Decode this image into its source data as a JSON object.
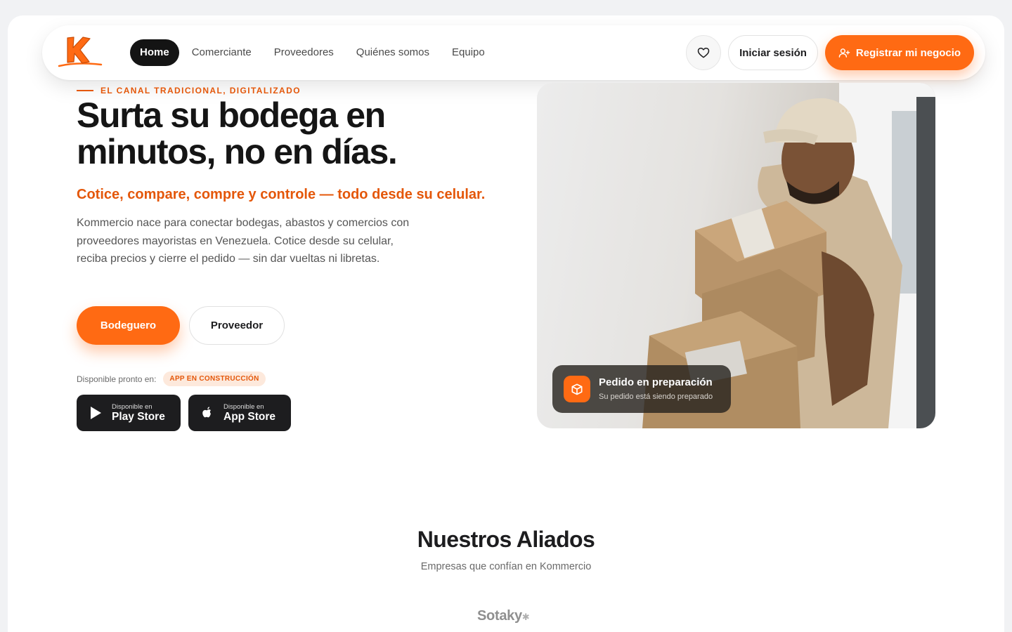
{
  "nav": {
    "links": [
      {
        "label": "Home",
        "active": true
      },
      {
        "label": "Comerciante"
      },
      {
        "label": "Proveedores"
      },
      {
        "label": "Quiénes somos"
      },
      {
        "label": "Equipo"
      }
    ],
    "login_label": "Iniciar sesión",
    "register_label": "Registrar mi negocio"
  },
  "hero": {
    "eyebrow": "EL CANAL TRADICIONAL, DIGITALIZADO",
    "title_line1": "Surta su bodega en",
    "title_line2": "minutos, no en días.",
    "subtitle": "Cotice, compare, compre y controle — todo desde su celular.",
    "description": "Kommercio nace para conectar bodegas, abastos y comercios con proveedores mayoristas en Venezuela. Cotice desde su celular, reciba precios y cierre el pedido — sin dar vueltas ni libretas.",
    "primary_label": "Bodeguero",
    "secondary_label": "Proveedor",
    "available_label": "Disponible pronto en:",
    "badge_label": "APP EN CONSTRUCCIÓN",
    "play_small": "Disponible en",
    "play_big": "Play Store",
    "apple_small": "Disponible en",
    "apple_big": "App Store"
  },
  "order_card": {
    "title": "Pedido en preparación",
    "subtitle": "Su pedido está siendo preparado"
  },
  "allies": {
    "title": "Nuestros Aliados",
    "subtitle": "Empresas que confían en Kommercio",
    "logo": "Sotaky"
  },
  "colors": {
    "accent": "#ff6a13",
    "accent_text": "#e4570a",
    "dark": "#141414"
  }
}
